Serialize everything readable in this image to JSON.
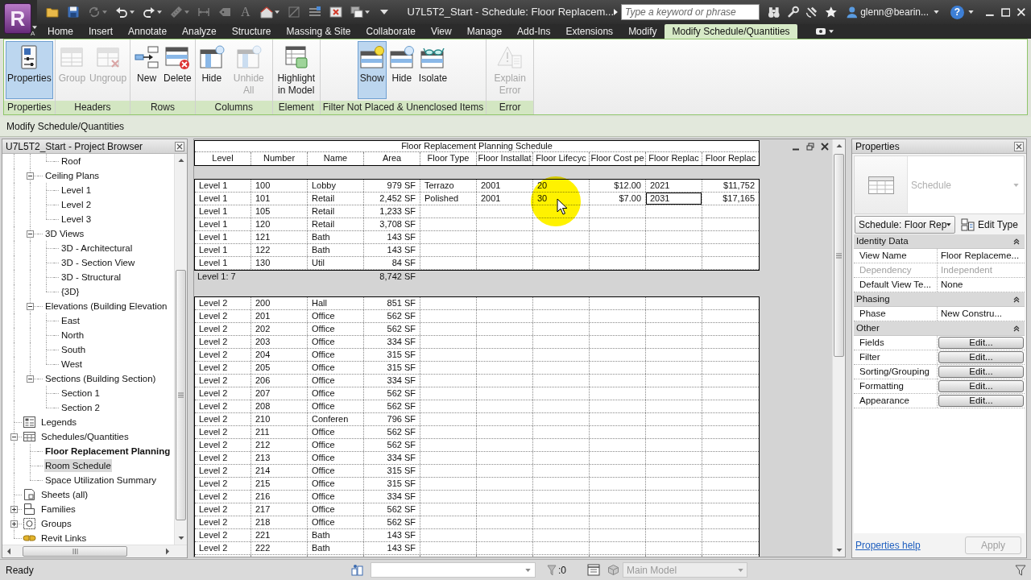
{
  "app": {
    "logo": "R",
    "logo_badge": "A",
    "title": "U7L5T2_Start - Schedule: Floor Replacem...",
    "search": {
      "placeholder": "Type a keyword or phrase"
    },
    "user": "glenn@bearin...",
    "help": "?"
  },
  "quick_access": [
    {
      "kind": "open",
      "disabled": false,
      "menu": false
    },
    {
      "kind": "save",
      "disabled": false,
      "menu": false
    },
    {
      "kind": "sync",
      "disabled": true,
      "menu": true
    },
    {
      "kind": "undo",
      "disabled": false,
      "menu": true
    },
    {
      "kind": "redo",
      "disabled": false,
      "menu": true
    },
    {
      "kind": "measure",
      "disabled": true,
      "menu": true
    },
    {
      "kind": "dimension",
      "disabled": true,
      "menu": false
    },
    {
      "kind": "tag",
      "disabled": true,
      "menu": false
    },
    {
      "kind": "text",
      "glyph": "A",
      "disabled": true,
      "menu": false
    },
    {
      "kind": "view3d",
      "disabled": false,
      "menu": true
    },
    {
      "kind": "section",
      "disabled": true,
      "menu": false
    },
    {
      "kind": "thinlines",
      "disabled": false,
      "menu": false
    },
    {
      "kind": "closewindows",
      "disabled": false,
      "menu": false
    },
    {
      "kind": "switchwindows",
      "disabled": false,
      "menu": true
    },
    {
      "kind": "customize",
      "disabled": false,
      "menu": false
    }
  ],
  "ribbon": {
    "tabs": [
      {
        "label": "Home",
        "selected": false
      },
      {
        "label": "Insert",
        "selected": false
      },
      {
        "label": "Annotate",
        "selected": false
      },
      {
        "label": "Analyze",
        "selected": false
      },
      {
        "label": "Structure",
        "selected": false
      },
      {
        "label": "Massing & Site",
        "selected": false
      },
      {
        "label": "Collaborate",
        "selected": false
      },
      {
        "label": "View",
        "selected": false
      },
      {
        "label": "Manage",
        "selected": false
      },
      {
        "label": "Add-Ins",
        "selected": false
      },
      {
        "label": "Extensions",
        "selected": false
      },
      {
        "label": "Modify",
        "selected": false
      },
      {
        "label": "Modify Schedule/Quantities",
        "selected": true
      }
    ],
    "panels": [
      {
        "label": "Properties",
        "buttons": [
          {
            "label": "Properties",
            "kind": "properties",
            "on": true,
            "disabled": false
          }
        ]
      },
      {
        "label": "Headers",
        "buttons": [
          {
            "label": "Group",
            "kind": "group",
            "on": false,
            "disabled": true
          },
          {
            "label": "Ungroup",
            "kind": "ungroup",
            "on": false,
            "disabled": true
          }
        ]
      },
      {
        "label": "Rows",
        "buttons": [
          {
            "label": "New",
            "kind": "insert_row",
            "on": false,
            "disabled": false
          },
          {
            "label": "Delete",
            "kind": "delete_row",
            "on": false,
            "disabled": false
          }
        ]
      },
      {
        "label": "Columns",
        "buttons": [
          {
            "label": "Hide",
            "kind": "hide_column",
            "on": false,
            "disabled": false
          },
          {
            "label": "Unhide All",
            "kind": "unhide_column",
            "on": false,
            "disabled": true
          }
        ]
      },
      {
        "label": "Element",
        "buttons": [
          {
            "label": "Highlight in Model",
            "kind": "highlight",
            "on": false,
            "disabled": false
          }
        ]
      },
      {
        "label": "Filter Not Placed & Unenclosed Items",
        "buttons": [
          {
            "label": "Show",
            "kind": "show",
            "on": true,
            "disabled": false
          },
          {
            "label": "Hide",
            "kind": "hide_items",
            "on": false,
            "disabled": false
          },
          {
            "label": "Isolate",
            "kind": "isolate",
            "on": false,
            "disabled": false
          }
        ]
      },
      {
        "label": "Error",
        "buttons": [
          {
            "label": "Explain Error",
            "kind": "explain",
            "on": false,
            "disabled": true
          }
        ]
      }
    ]
  },
  "options_bar": {
    "label": "Modify Schedule/Quantities"
  },
  "project_browser": {
    "title": "U7L5T2_Start - Project Browser",
    "items": [
      {
        "children": [
          {
            "children": [
              {
                "label": "Roof",
                "selected": false,
                "open": false
              }
            ]
          },
          {
            "label": "Ceiling Plans",
            "expanded": true,
            "selected": false,
            "children": [
              {
                "label": "Level 1",
                "selected": false,
                "open": false
              },
              {
                "label": "Level 2",
                "selected": false,
                "open": false
              },
              {
                "label": "Level 3",
                "selected": false,
                "open": false
              }
            ]
          },
          {
            "label": "3D Views",
            "expanded": true,
            "selected": false,
            "children": [
              {
                "label": "3D - Architectural",
                "selected": false,
                "open": false
              },
              {
                "label": "3D - Section View",
                "selected": false,
                "open": false
              },
              {
                "label": "3D - Structural",
                "selected": false,
                "open": false
              },
              {
                "label": "{3D}",
                "selected": false,
                "open": false
              }
            ]
          },
          {
            "label": "Elevations (Building Elevation",
            "expanded": true,
            "selected": false,
            "children": [
              {
                "label": "East",
                "selected": false,
                "open": false
              },
              {
                "label": "North",
                "selected": false,
                "open": false
              },
              {
                "label": "South",
                "selected": false,
                "open": false
              },
              {
                "label": "West",
                "selected": false,
                "open": false
              }
            ]
          },
          {
            "label": "Sections (Building Section)",
            "expanded": true,
            "selected": false,
            "children": [
              {
                "label": "Section 1",
                "selected": false,
                "open": false
              },
              {
                "label": "Section 2",
                "selected": false,
                "open": false
              }
            ]
          }
        ]
      },
      {
        "label": "Legends",
        "kind": "legends",
        "selected": false
      },
      {
        "label": "Schedules/Quantities",
        "kind": "schedules",
        "expanded": true,
        "selected": false,
        "children": [
          {
            "label": "Floor Replacement Planning",
            "selected": false,
            "open": true
          },
          {
            "label": "Room Schedule",
            "selected": true,
            "open": false
          },
          {
            "label": "Space Utilization Summary",
            "selected": false,
            "open": false
          }
        ]
      },
      {
        "label": "Sheets (all)",
        "kind": "sheets",
        "selected": false
      },
      {
        "label": "Families",
        "kind": "families",
        "expanded": false,
        "selected": false
      },
      {
        "label": "Groups",
        "kind": "groups",
        "expanded": false,
        "selected": false
      },
      {
        "label": "Revit Links",
        "kind": "links",
        "selected": false
      }
    ]
  },
  "schedule": {
    "title": "Floor Replacement Planning Schedule",
    "columns": [
      {
        "label": "Level",
        "kind": "text"
      },
      {
        "label": "Number",
        "kind": "text"
      },
      {
        "label": "Name",
        "kind": "text"
      },
      {
        "label": "Area",
        "kind": "quantity"
      },
      {
        "label": "Floor Type",
        "kind": "text"
      },
      {
        "label": "Floor Installat",
        "kind": "text"
      },
      {
        "label": "Floor Lifecyc",
        "kind": "text"
      },
      {
        "label": "Floor Cost pe",
        "kind": "quantity"
      },
      {
        "label": "Floor Replac",
        "kind": "text"
      },
      {
        "label": "Floor Replac",
        "kind": "quantity"
      }
    ],
    "groups": [
      {
        "rows": [
          [
            "Level 1",
            "100",
            "Lobby",
            "979 SF",
            "Terrazo",
            "2001",
            "20",
            "$12.00",
            "2021",
            "$11,752"
          ],
          [
            "Level 1",
            "101",
            "Retail",
            "2,452 SF",
            "Polished",
            "2001",
            "30",
            "$7.00",
            {
              "text": "2031",
              "selected": true
            },
            "$17,165"
          ],
          [
            "Level 1",
            "105",
            "Retail",
            "1,233 SF"
          ],
          [
            "Level 1",
            "120",
            "Retail",
            "3,708 SF"
          ],
          [
            "Level 1",
            "121",
            "Bath",
            "143 SF"
          ],
          [
            "Level 1",
            "122",
            "Bath",
            "143 SF"
          ],
          [
            "Level 1",
            "130",
            "Util",
            "84 SF"
          ]
        ],
        "footer": {
          "label": "Level 1: 7",
          "area_total": "8,742 SF"
        }
      },
      {
        "rows": [
          [
            "Level 2",
            "200",
            "Hall",
            "851 SF"
          ],
          [
            "Level 2",
            "201",
            "Office",
            "562 SF"
          ],
          [
            "Level 2",
            "202",
            "Office",
            "562 SF"
          ],
          [
            "Level 2",
            "203",
            "Office",
            "334 SF"
          ],
          [
            "Level 2",
            "204",
            "Office",
            "315 SF"
          ],
          [
            "Level 2",
            "205",
            "Office",
            "315 SF"
          ],
          [
            "Level 2",
            "206",
            "Office",
            "334 SF"
          ],
          [
            "Level 2",
            "207",
            "Office",
            "562 SF"
          ],
          [
            "Level 2",
            "208",
            "Office",
            "562 SF"
          ],
          [
            "Level 2",
            "210",
            "Conferen",
            "796 SF"
          ],
          [
            "Level 2",
            "211",
            "Office",
            "562 SF"
          ],
          [
            "Level 2",
            "212",
            "Office",
            "562 SF"
          ],
          [
            "Level 2",
            "213",
            "Office",
            "334 SF"
          ],
          [
            "Level 2",
            "214",
            "Office",
            "315 SF"
          ],
          [
            "Level 2",
            "215",
            "Office",
            "315 SF"
          ],
          [
            "Level 2",
            "216",
            "Office",
            "334 SF"
          ],
          [
            "Level 2",
            "217",
            "Office",
            "562 SF"
          ],
          [
            "Level 2",
            "218",
            "Office",
            "562 SF"
          ],
          [
            "Level 2",
            "221",
            "Bath",
            "143 SF"
          ],
          [
            "Level 2",
            "222",
            "Bath",
            "143 SF"
          ]
        ]
      }
    ]
  },
  "properties": {
    "title": "Properties",
    "type_selector": {
      "name": "Schedule",
      "disabled": true
    },
    "instance": "Schedule: Floor Rep",
    "edit_type": "Edit Type",
    "groups": [
      {
        "label": "Identity Data",
        "expanded": true,
        "rows": [
          {
            "name": "View Name",
            "kind": "text",
            "value": "Floor Replaceme...",
            "disabled": false
          },
          {
            "name": "Dependency",
            "kind": "text",
            "value": "Independent",
            "disabled": true
          },
          {
            "name": "Default View Te...",
            "kind": "text",
            "value": "None",
            "disabled": false
          }
        ]
      },
      {
        "label": "Phasing",
        "expanded": true,
        "rows": [
          {
            "name": "Phase",
            "kind": "text",
            "value": "New Constru...",
            "disabled": false
          }
        ]
      },
      {
        "label": "Other",
        "expanded": true,
        "rows": [
          {
            "name": "Fields",
            "kind": "button",
            "value": "Edit...",
            "disabled": false
          },
          {
            "name": "Filter",
            "kind": "button",
            "value": "Edit...",
            "disabled": false
          },
          {
            "name": "Sorting/Grouping",
            "kind": "button",
            "value": "Edit...",
            "disabled": false
          },
          {
            "name": "Formatting",
            "kind": "button",
            "value": "Edit...",
            "disabled": false
          },
          {
            "name": "Appearance",
            "kind": "button",
            "value": "Edit...",
            "disabled": false
          }
        ]
      }
    ],
    "help_link": "Properties help",
    "apply": {
      "label": "Apply",
      "disabled": true
    }
  },
  "status_bar": {
    "text": "Ready",
    "selection_count": ":0",
    "model": {
      "value": "Main Model",
      "disabled": true
    }
  }
}
